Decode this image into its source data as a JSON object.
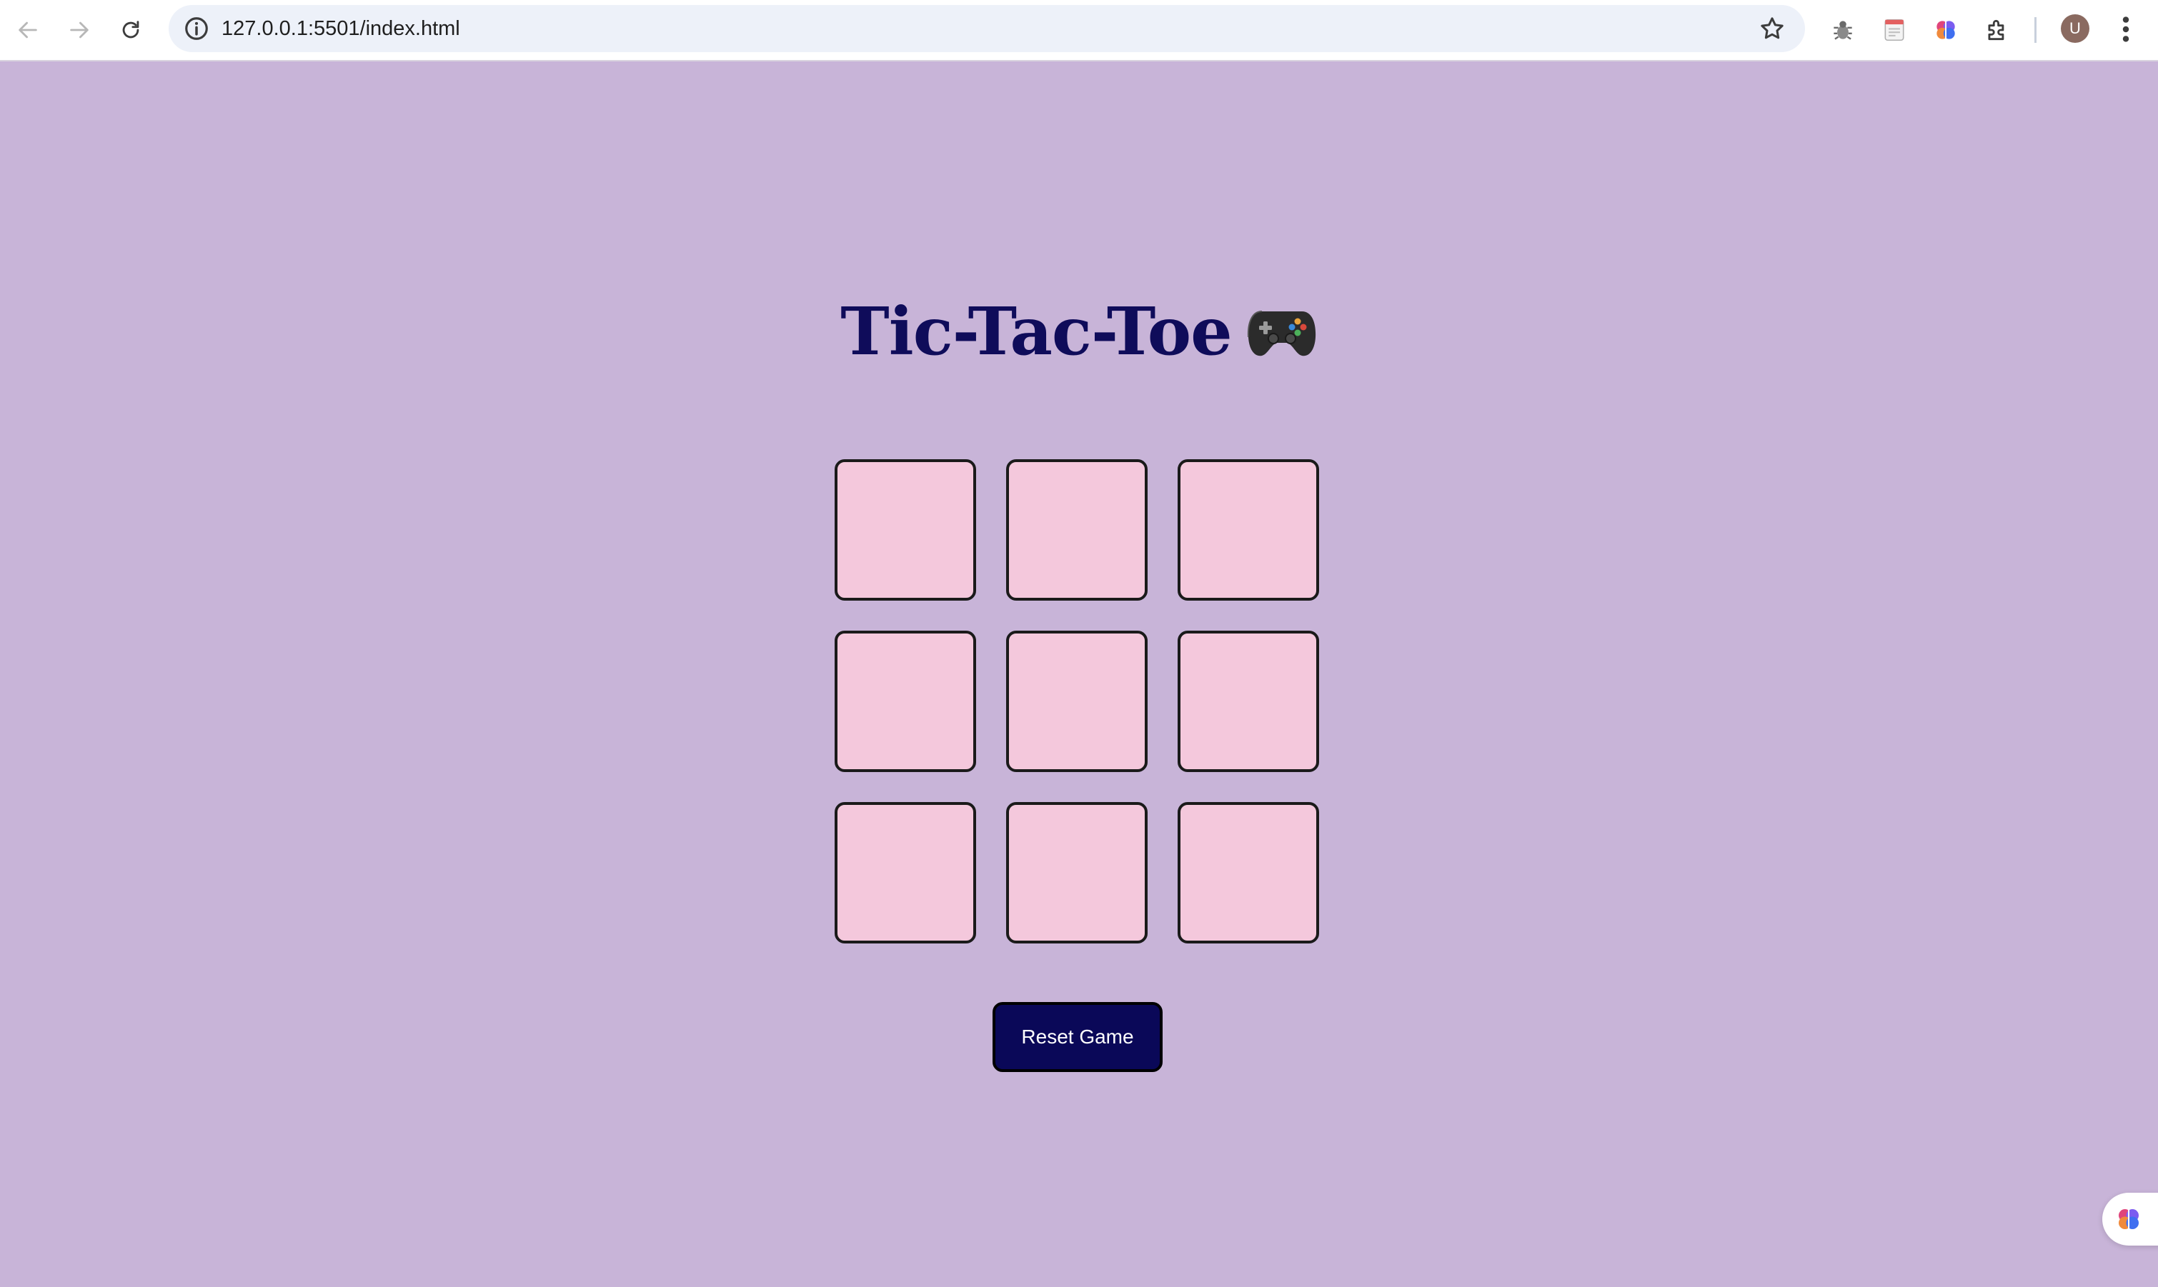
{
  "browser": {
    "url": "127.0.0.1:5501/index.html",
    "profile_initial": "U",
    "icons": {
      "back": "arrow-left-icon",
      "forward": "arrow-right-icon",
      "reload": "reload-icon",
      "site_info": "info-icon",
      "bookmark": "star-icon",
      "extensions": [
        "bug-extension-icon",
        "notes-extension-icon",
        "brain-extension-icon",
        "puzzle-icon"
      ],
      "menu": "kebab-menu-icon"
    }
  },
  "page": {
    "background": "#c8b4d8",
    "title": "Tic-Tac-Toe",
    "title_emoji": "game-controller-icon",
    "board": {
      "cells": [
        "",
        "",
        "",
        "",
        "",
        "",
        "",
        "",
        ""
      ]
    },
    "reset_label": "Reset Game",
    "colors": {
      "title": "#0f0c5a",
      "cell_fill": "#f4c8dc",
      "button_fill": "#0a0858"
    }
  }
}
